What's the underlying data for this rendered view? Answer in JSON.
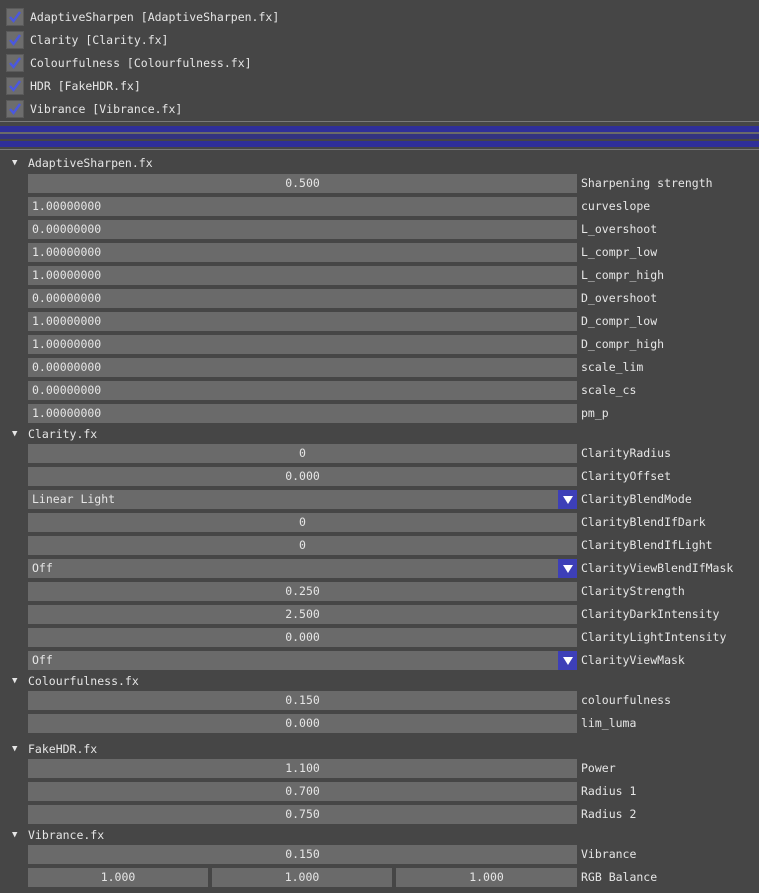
{
  "effects": [
    {
      "label": "AdaptiveSharpen [AdaptiveSharpen.fx]",
      "checked": true
    },
    {
      "label": "Clarity [Clarity.fx]",
      "checked": true
    },
    {
      "label": "Colourfulness [Colourfulness.fx]",
      "checked": true
    },
    {
      "label": "HDR [FakeHDR.fx]",
      "checked": true
    },
    {
      "label": "Vibrance [Vibrance.fx]",
      "checked": true
    }
  ],
  "colors": {
    "background": "#464646",
    "field": "#6a6a6a",
    "checkmark": "#4a58e0",
    "accent": "#3d3fb8"
  },
  "sections": [
    {
      "title": "AdaptiveSharpen.fx",
      "params": [
        {
          "value": "0.500",
          "label": "Sharpening strength"
        },
        {
          "value": "1.00000000",
          "label": "curveslope"
        },
        {
          "value": "0.00000000",
          "label": "L_overshoot"
        },
        {
          "value": "1.00000000",
          "label": "L_compr_low"
        },
        {
          "value": "1.00000000",
          "label": "L_compr_high"
        },
        {
          "value": "0.00000000",
          "label": "D_overshoot"
        },
        {
          "value": "1.00000000",
          "label": "D_compr_low"
        },
        {
          "value": "1.00000000",
          "label": "D_compr_high"
        },
        {
          "value": "0.00000000",
          "label": "scale_lim"
        },
        {
          "value": "0.00000000",
          "label": "scale_cs"
        },
        {
          "value": "1.00000000",
          "label": "pm_p"
        }
      ]
    },
    {
      "title": "Clarity.fx",
      "params": [
        {
          "value": "0",
          "label": "ClarityRadius"
        },
        {
          "value": "0.000",
          "label": "ClarityOffset"
        },
        {
          "value": "Linear Light",
          "label": "ClarityBlendMode"
        },
        {
          "value": "0",
          "label": "ClarityBlendIfDark"
        },
        {
          "value": "0",
          "label": "ClarityBlendIfLight"
        },
        {
          "value": "Off",
          "label": "ClarityViewBlendIfMask"
        },
        {
          "value": "0.250",
          "label": "ClarityStrength"
        },
        {
          "value": "2.500",
          "label": "ClarityDarkIntensity"
        },
        {
          "value": "0.000",
          "label": "ClarityLightIntensity"
        },
        {
          "value": "Off",
          "label": "ClarityViewMask"
        }
      ]
    },
    {
      "title": "Colourfulness.fx",
      "params": [
        {
          "value": "0.150",
          "label": "colourfulness"
        },
        {
          "value": "0.000",
          "label": "lim_luma"
        }
      ]
    },
    {
      "title": "FakeHDR.fx",
      "params": [
        {
          "value": "1.100",
          "label": "Power"
        },
        {
          "value": "0.700",
          "label": "Radius 1"
        },
        {
          "value": "0.750",
          "label": "Radius 2"
        }
      ]
    },
    {
      "title": "Vibrance.fx",
      "params": [
        {
          "value": "0.150",
          "label": "Vibrance"
        },
        {
          "values": [
            "1.000",
            "1.000",
            "1.000"
          ],
          "label": "RGB Balance"
        }
      ]
    }
  ]
}
